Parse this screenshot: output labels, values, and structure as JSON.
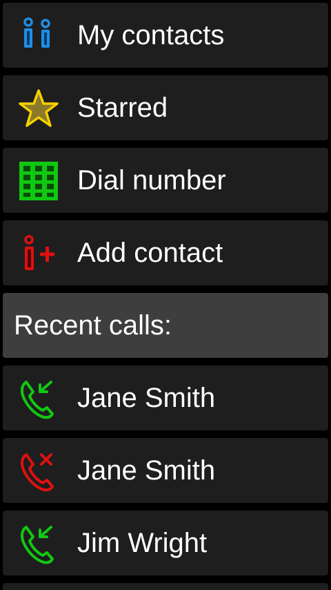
{
  "menu": {
    "my_contacts": {
      "label": "My contacts",
      "icon": "contacts-icon",
      "color": "#1e8fe6"
    },
    "starred": {
      "label": "Starred",
      "icon": "star-icon",
      "color": "#f5d000"
    },
    "dial_number": {
      "label": "Dial number",
      "icon": "dialpad-icon",
      "color": "#11c811"
    },
    "add_contact": {
      "label": "Add contact",
      "icon": "add-contact-icon",
      "color": "#e01010"
    }
  },
  "recent": {
    "header": "Recent calls:",
    "calls": [
      {
        "name": "Jane Smith",
        "type": "incoming",
        "icon": "incoming-call-icon",
        "color": "#11c811"
      },
      {
        "name": "Jane Smith",
        "type": "missed",
        "icon": "missed-call-icon",
        "color": "#e01010"
      },
      {
        "name": "Jim Wright",
        "type": "incoming",
        "icon": "incoming-call-icon",
        "color": "#11c811"
      }
    ]
  }
}
